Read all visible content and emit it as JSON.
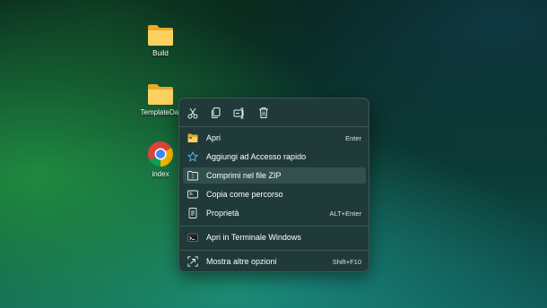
{
  "desktop": {
    "icons": [
      {
        "label": "Build",
        "icon": "folder-icon"
      },
      {
        "label": "TemplateDat",
        "icon": "folder-icon"
      },
      {
        "label": "index",
        "icon": "chrome-icon"
      }
    ]
  },
  "context_menu": {
    "toolbar": [
      {
        "name": "cut-icon"
      },
      {
        "name": "copy-icon"
      },
      {
        "name": "rename-icon"
      },
      {
        "name": "delete-icon"
      }
    ],
    "items": [
      {
        "label": "Apri",
        "shortcut": "Enter",
        "icon": "folder-open-icon"
      },
      {
        "label": "Aggiungi ad Accesso rapido",
        "shortcut": "",
        "icon": "star-icon"
      },
      {
        "label": "Comprimi nel file ZIP",
        "shortcut": "",
        "icon": "zip-folder-icon"
      },
      {
        "label": "Copia come percorso",
        "shortcut": "",
        "icon": "path-icon"
      },
      {
        "label": "Proprietà",
        "shortcut": "ALT+Enter",
        "icon": "properties-icon"
      },
      {
        "label": "Apri in Terminale Windows",
        "shortcut": "",
        "icon": "terminal-icon"
      },
      {
        "label": "Mostra altre opzioni",
        "shortcut": "Shift+F10",
        "icon": "more-options-icon"
      }
    ],
    "highlighted_item": "Comprimi nel file ZIP"
  },
  "colors": {
    "menu_background": "#203a3a",
    "menu_highlight": "#33504f",
    "folder": "#f7c948"
  }
}
